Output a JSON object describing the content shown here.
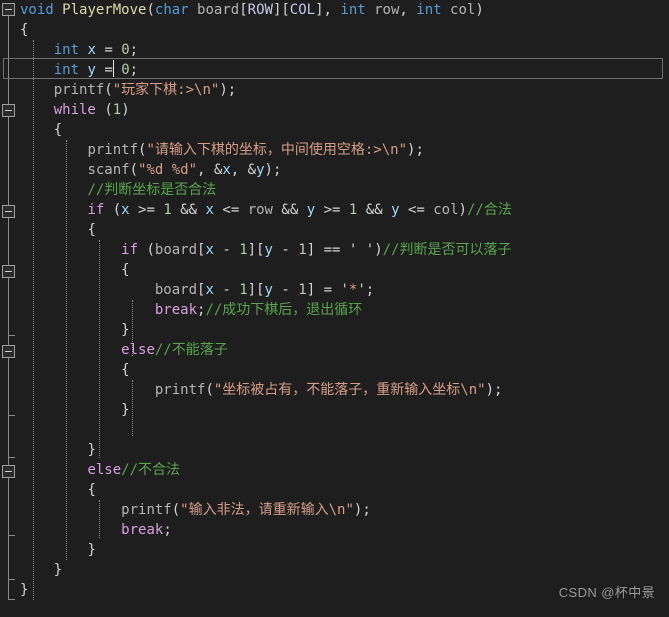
{
  "app": {
    "kind": "code-editor",
    "theme": "visual-studio-dark",
    "background_color": "#1e1e1e",
    "language": "c"
  },
  "colors": {
    "keyword": "#569cd6",
    "control_keyword": "#d8a0df",
    "function": "#dcdcaa",
    "string": "#d69d85",
    "comment": "#57a64a",
    "variable": "#9cdcfe",
    "macro": "#c8c8e8",
    "plain": "#b4b4b4",
    "number": "#b5cea8",
    "gutter_line": "#8a8a8a",
    "current_line_border": "#6e6e6e"
  },
  "code": {
    "lines": [
      "void PlayerMove(char board[ROW][COL], int row, int col)",
      "{",
      "    int x = 0;",
      "    int y = 0;",
      "    printf(\"玩家下棋:>\\n\");",
      "    while (1)",
      "    {",
      "        printf(\"请输入下棋的坐标，中间使用空格:>\\n\");",
      "        scanf(\"%d %d\", &x, &y);",
      "        //判断坐标是否合法",
      "        if (x >= 1 && x <= row && y >= 1 && y <= col)//合法",
      "        {",
      "            if (board[x - 1][y - 1] == ' ')//判断是否可以落子",
      "            {",
      "                board[x - 1][y - 1] = '*';",
      "                break;//成功下棋后，退出循环",
      "            }",
      "            else//不能落子",
      "            {",
      "                printf(\"坐标被占有，不能落子，重新输入坐标\\n\");",
      "            }",
      "",
      "        }",
      "        else//不合法",
      "        {",
      "            printf(\"输入非法，请重新输入\\n\");",
      "            break;",
      "        }",
      "    }",
      "}"
    ],
    "current_line_index": 3,
    "current_line_text": "    int y = 0;"
  },
  "strings": {
    "player_move_prompt": "玩家下棋:>\\n",
    "input_coord_prompt": "请输入下棋的坐标，中间使用空格:>\\n",
    "scanf_format": "%d %d",
    "occupied_prompt": "坐标被占有，不能落子，重新输入坐标\\n",
    "illegal_prompt": "输入非法，请重新输入\\n",
    "star_char": "*",
    "space_char": " "
  },
  "comments": {
    "check_coord_legal": "//判断坐标是否合法",
    "legal": "//合法",
    "can_place": "//判断是否可以落子",
    "break_after_success": "//成功下棋后，退出循环",
    "cannot_place": "//不能落子",
    "illegal": "//不合法"
  },
  "identifiers": {
    "function_name": "PlayerMove",
    "param_board": "board",
    "macro_row": "ROW",
    "macro_col": "COL",
    "param_row": "row",
    "param_col": "col",
    "var_x": "x",
    "var_y": "y"
  },
  "gutter": {
    "fold_markers": [
      {
        "name": "fold-function",
        "line": 0
      },
      {
        "name": "fold-while",
        "line": 5
      },
      {
        "name": "fold-if-outer",
        "line": 10
      },
      {
        "name": "fold-if-inner",
        "line": 13
      },
      {
        "name": "fold-else-inner",
        "line": 17
      },
      {
        "name": "fold-else-outer",
        "line": 23
      }
    ],
    "marker_glyph": "minus"
  },
  "watermark": {
    "text": "CSDN @杯中景"
  }
}
